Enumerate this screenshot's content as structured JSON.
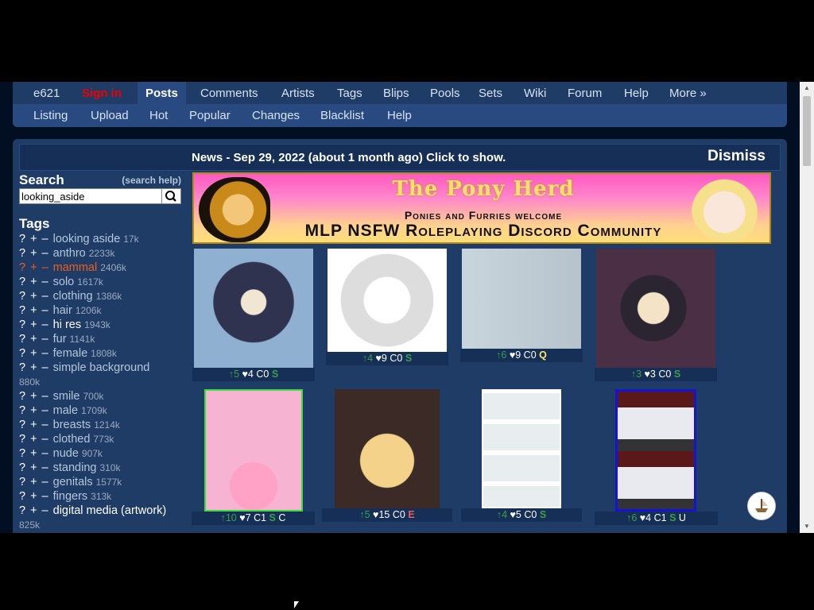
{
  "topnav": {
    "items": [
      "e621",
      "Sign in",
      "Posts",
      "Comments",
      "Artists",
      "Tags",
      "Blips",
      "Pools",
      "Sets",
      "Wiki",
      "Forum",
      "Help",
      "More »"
    ]
  },
  "subnav": {
    "items": [
      "Listing",
      "Upload",
      "Hot",
      "Popular",
      "Changes",
      "Blacklist",
      "Help"
    ]
  },
  "news": {
    "text": "News - Sep 29, 2022 (about 1 month ago) Click to show.",
    "dismiss": "Dismiss"
  },
  "search": {
    "title": "Search",
    "help": "(search help)",
    "value": "looking_aside"
  },
  "tags": {
    "title": "Tags",
    "items": [
      {
        "name": "looking aside",
        "count": "17k"
      },
      {
        "name": "anthro",
        "count": "2233k"
      },
      {
        "name": "mammal",
        "count": "2406k"
      },
      {
        "name": "solo",
        "count": "1617k"
      },
      {
        "name": "clothing",
        "count": "1386k"
      },
      {
        "name": "hair",
        "count": "1206k"
      },
      {
        "name": "hi res",
        "count": "1943k"
      },
      {
        "name": "fur",
        "count": "1141k"
      },
      {
        "name": "female",
        "count": "1808k"
      },
      {
        "name": "simple background",
        "count": "880k"
      },
      {
        "name": "smile",
        "count": "700k"
      },
      {
        "name": "male",
        "count": "1709k"
      },
      {
        "name": "breasts",
        "count": "1214k"
      },
      {
        "name": "clothed",
        "count": "773k"
      },
      {
        "name": "nude",
        "count": "907k"
      },
      {
        "name": "standing",
        "count": "310k"
      },
      {
        "name": "genitals",
        "count": "1577k"
      },
      {
        "name": "fingers",
        "count": "313k"
      },
      {
        "name": "digital media (artwork)",
        "count": "825k"
      }
    ],
    "q": "?",
    "plus": "+",
    "minus": "–"
  },
  "banner": {
    "title": "The Pony Herd",
    "line2": "Ponies and Furries welcome",
    "line3": "MLP NSFW Roleplaying Discord Community"
  },
  "posts": [
    {
      "up": "↑5",
      "fav": "♥4",
      "comments": "C0",
      "rating": "S"
    },
    {
      "up": "↑4",
      "fav": "♥9",
      "comments": "C0",
      "rating": "S"
    },
    {
      "up": "↑6",
      "fav": "♥9",
      "comments": "C0",
      "rating": "Q"
    },
    {
      "up": "↑3",
      "fav": "♥3",
      "comments": "C0",
      "rating": "S"
    },
    {
      "up": "↑10",
      "fav": "♥7",
      "comments": "C1",
      "rating": "S",
      "extra": "C"
    },
    {
      "up": "↑5",
      "fav": "♥15",
      "comments": "C0",
      "rating": "E"
    },
    {
      "up": "↑4",
      "fav": "♥5",
      "comments": "C0",
      "rating": "S"
    },
    {
      "up": "↑6",
      "fav": "♥4",
      "comments": "C1",
      "rating": "S",
      "extra": "U"
    }
  ],
  "icons": {
    "search": "search-icon",
    "fab": "ship-icon"
  }
}
